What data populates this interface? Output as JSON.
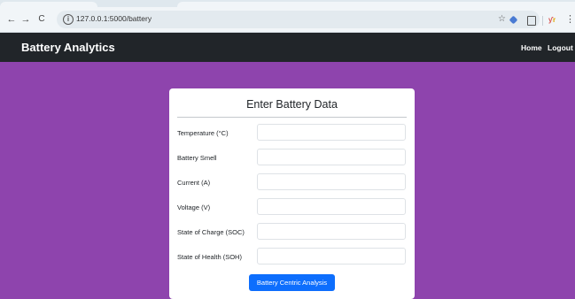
{
  "browser": {
    "url": "127.0.0.1:5000/battery",
    "icons": [
      "back-arrow-icon",
      "forward-arrow-icon",
      "reload-icon",
      "info-icon",
      "star-icon",
      "extension-icon",
      "puzzle-icon",
      "profile-icon",
      "kebab-menu-icon"
    ],
    "glyphs": {
      "back": "←",
      "forward": "→",
      "reload": "C",
      "info": "i",
      "star": "☆",
      "kebab": "⋮"
    }
  },
  "navbar": {
    "brand": "Battery Analytics",
    "links": [
      "Home",
      "Logout"
    ]
  },
  "form": {
    "title": "Enter Battery Data",
    "fields": [
      {
        "label": "Temperature (°C)",
        "value": ""
      },
      {
        "label": "Battery Smell",
        "value": ""
      },
      {
        "label": "Current (A)",
        "value": ""
      },
      {
        "label": "Voltage (V)",
        "value": ""
      },
      {
        "label": "State of Charge (SOC)",
        "value": ""
      },
      {
        "label": "State of Health (SOH)",
        "value": ""
      }
    ],
    "submit_label": "Battery Centric Analysis"
  },
  "colors": {
    "page_background": "#8e44ad",
    "navbar_background": "#212529",
    "button_primary": "#0d6efd"
  }
}
